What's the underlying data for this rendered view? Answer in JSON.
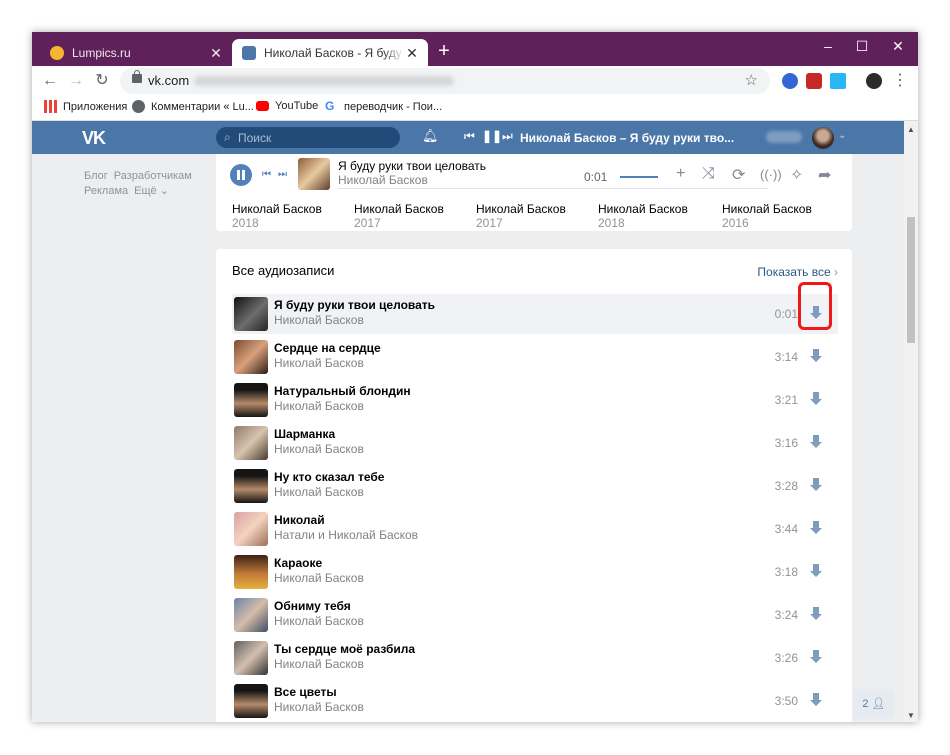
{
  "browser": {
    "tabs": [
      {
        "title": "Lumpics.ru",
        "active": false
      },
      {
        "title": "Николай Басков - Я буду руки т",
        "active": true
      }
    ],
    "url": "vk.com",
    "bookmarks": [
      "Приложения",
      "Комментарии « Lu...",
      "YouTube",
      "переводчик - Пои..."
    ]
  },
  "vk_header": {
    "logo": "VK",
    "search_placeholder": "Поиск",
    "now_playing": "Николай Басков – Я буду руки тво..."
  },
  "left_nav": {
    "links": [
      "Блог",
      "Разработчикам",
      "Реклама",
      "Ещё ⌄"
    ]
  },
  "player": {
    "title": "Я буду руки твои целовать",
    "artist": "Николай Басков",
    "time": "0:01"
  },
  "albums": [
    {
      "artist": "Николай Басков",
      "year": "2018"
    },
    {
      "artist": "Николай Басков",
      "year": "2017"
    },
    {
      "artist": "Николай Басков",
      "year": "2017"
    },
    {
      "artist": "Николай Басков",
      "year": "2018"
    },
    {
      "artist": "Николай Басков",
      "year": "2016"
    }
  ],
  "tracks_section": {
    "heading": "Все аудиозаписи",
    "show_all": "Показать все",
    "tracks": [
      {
        "title": "Я буду руки твои целовать",
        "artist": "Николай Басков",
        "duration": "0:01"
      },
      {
        "title": "Сердце на сердце",
        "artist": "Николай Басков",
        "duration": "3:14"
      },
      {
        "title": "Натуральный блондин",
        "artist": "Николай Басков",
        "duration": "3:21"
      },
      {
        "title": "Шарманка",
        "artist": "Николай Басков",
        "duration": "3:16"
      },
      {
        "title": "Ну кто сказал тебе",
        "artist": "Николай Басков",
        "duration": "3:28"
      },
      {
        "title": "Николай",
        "artist": "Натали и Николай Басков",
        "duration": "3:44"
      },
      {
        "title": "Караоке",
        "artist": "Николай Басков",
        "duration": "3:18"
      },
      {
        "title": "Обниму тебя",
        "artist": "Николай Басков",
        "duration": "3:24"
      },
      {
        "title": "Ты сердце моё разбила",
        "artist": "Николай Басков",
        "duration": "3:26"
      },
      {
        "title": "Все цветы",
        "artist": "Николай Басков",
        "duration": "3:50"
      }
    ]
  },
  "friends_widget": {
    "count": "2"
  },
  "colors": {
    "vk_blue": "#4a76a8",
    "title_bar": "#5f2159",
    "highlight": "#ef1919"
  }
}
